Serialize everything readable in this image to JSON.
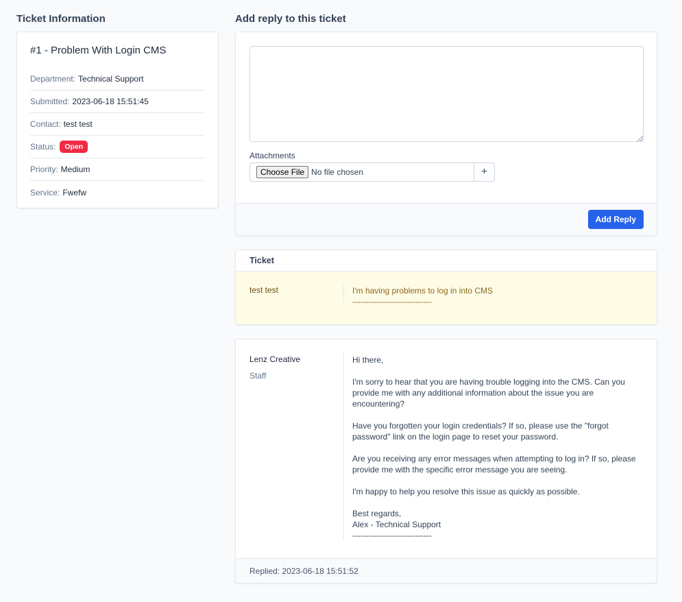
{
  "ticket_info": {
    "section_title": "Ticket Information",
    "heading": "#1 - Problem With Login CMS",
    "fields": [
      {
        "label": "Department:",
        "value": "Technical Support"
      },
      {
        "label": "Submitted:",
        "value": "2023-06-18 15:51:45"
      },
      {
        "label": "Contact:",
        "value": "test test"
      },
      {
        "label": "Status:",
        "value": "Open"
      },
      {
        "label": "Priority:",
        "value": "Medium"
      },
      {
        "label": "Service:",
        "value": "Fwefw"
      }
    ],
    "status_color": "#ef2b45"
  },
  "reply_form": {
    "section_title": "Add reply to this ticket",
    "textarea_value": "",
    "attachments_label": "Attachments",
    "choose_file_label": "Choose File",
    "no_file_text": "No file chosen",
    "add_attachment_symbol": "+",
    "submit_label": "Add Reply",
    "accent_color": "#2563eb"
  },
  "ticket_message": {
    "header": "Ticket",
    "author": "test test",
    "lines": [
      "I'm having problems to log in into CMS",
      "-----------------------------"
    ],
    "background_color": "#fefbe6"
  },
  "staff_reply": {
    "author": "Lenz Creative",
    "role": "Staff",
    "paragraphs": [
      "Hi there,",
      "I'm sorry to hear that you are having trouble logging into the CMS. Can you provide me with any additional information about the issue you are encountering?",
      "Have you forgotten your login credentials? If so, please use the \"forgot password\" link on the login page to reset your password.",
      "Are you receiving any error messages when attempting to log in? If so, please provide me with the specific error message you are seeing.",
      "I'm happy to help you resolve this issue as quickly as possible."
    ],
    "signature_lines": [
      "Best regards,",
      "Alex - Technical Support",
      "-----------------------------"
    ],
    "replied_label": "Replied: 2023-06-18 15:51:52"
  }
}
